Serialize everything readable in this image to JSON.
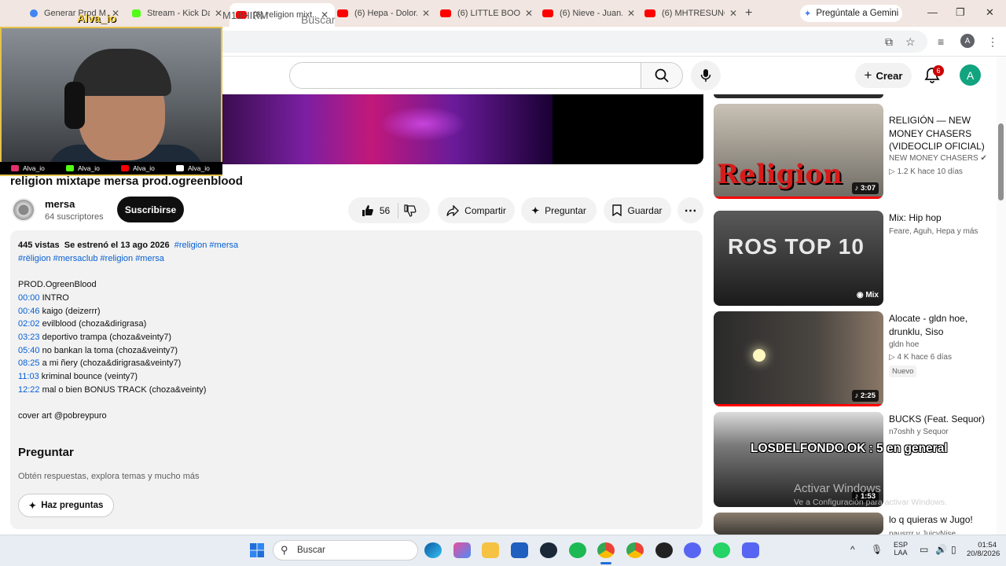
{
  "browser": {
    "tabs": [
      {
        "title": "Generar Prod M...",
        "color": "#4285f4"
      },
      {
        "title": "Stream - Kick Da...",
        "color": "#53fc18"
      },
      {
        "title": "(6) religion mixt...",
        "color": "#ff0000"
      },
      {
        "title": "(6) Hepa - Dolor...",
        "color": "#ff0000"
      },
      {
        "title": "(6) LITTLE BOOG...",
        "color": "#ff0000"
      },
      {
        "title": "(6) Nieve - Juan...",
        "color": "#ff0000"
      },
      {
        "title": "(6) MHTRESUNC...",
        "color": "#ff0000"
      }
    ],
    "tab_close": "✕",
    "new_tab": "+",
    "gemini_label": "Pregúntale a Gemini",
    "url_fragment": "M1dHIRM",
    "profile_initial": "A",
    "window_controls": [
      "—",
      "❐",
      "✕"
    ]
  },
  "webcam": {
    "streamer_name": "Alva_io",
    "socials": [
      {
        "label": "Alva_io",
        "color": "#e1306c"
      },
      {
        "label": "Alva_io",
        "color": "#53fc18"
      },
      {
        "label": "Alva_io",
        "color": "#ff0000"
      },
      {
        "label": "Alva_io",
        "color": "#ffffff"
      }
    ]
  },
  "header": {
    "search_placeholder": "Buscar",
    "create_label": "Crear",
    "notifications_count": "6",
    "avatar_initial": "A"
  },
  "video": {
    "title": "religion mixtape mersa prod.ogreenblood",
    "channel_name": "mersa",
    "subscribers": "64 suscriptores",
    "subscribe_label": "Suscribirse",
    "likes": "56",
    "share_label": "Compartir",
    "ask_label": "Preguntar",
    "save_label": "Guardar",
    "more_label": "⋯"
  },
  "description": {
    "views": "445 vistas",
    "premiered": "Se estrenó el 13 ago 2026",
    "hashtags_1": "#religion #mersa",
    "hashtags_2": "#rëligion #mersaclub #religion #mersa",
    "producer": "PROD.OgreenBlood",
    "chapters": [
      {
        "time": "00:00",
        "label": "INTRO"
      },
      {
        "time": "00:46",
        "label": "kaigo (deizerrr)"
      },
      {
        "time": "02:02",
        "label": "evilblood (choza&dirigrasa)"
      },
      {
        "time": "03:23",
        "label": "deportivo trampa (choza&veinty7)"
      },
      {
        "time": "05:40",
        "label": "no bankan la toma (choza&veinty7)"
      },
      {
        "time": "08:25",
        "label": "a mi ñery (choza&dirigrasa&veinty7)"
      },
      {
        "time": "11:03",
        "label": "kriminal bounce (veinty7)"
      },
      {
        "time": "12:22",
        "label": "mal o bien BONUS TRACK (choza&veinty)"
      }
    ],
    "cover_art": "cover art @pobreypuro",
    "ask_title": "Preguntar",
    "ask_subtitle": "Obtén respuestas, explora temas y mucho más",
    "ask_button": "Haz preguntas"
  },
  "recommendations": [
    {
      "title": "RELIGIÓN — NEW MONEY CHASERS (VIDEOCLIP OFICIAL)",
      "channel": "NEW MONEY CHASERS",
      "stats": "1.2 K   hace 10 días",
      "duration": "3:07",
      "thumb_text": "Religion",
      "colors": [
        "#c9c2b5",
        "#6e6a63"
      ]
    },
    {
      "title": "Mix: Hip hop",
      "channel": "Feare, Aguh, Hepa y más",
      "stats": "",
      "duration": "Mix",
      "thumb_text": "ROS TOP 10",
      "colors": [
        "#5a5a5a",
        "#1a1a1a"
      ]
    },
    {
      "title": "Alocate - gldn hoe, drunklu, Siso",
      "channel": "gldn hoe",
      "stats": "4 K   hace 6 días",
      "duration": "2:25",
      "badge": "Nuevo",
      "colors": [
        "#3a3a3a",
        "#101010"
      ]
    },
    {
      "title": "BUCKS (Feat. Sequor)",
      "channel": "n7oshh y Sequor",
      "stats": "",
      "duration": "1:53",
      "colors": [
        "#7a7a7a",
        "#202020"
      ]
    },
    {
      "title": "lo q quieras w Jugo!",
      "channel": "pausrrr y JuicyNise",
      "stats": "",
      "duration": "",
      "colors": [
        "#8a7d6e",
        "#3e3a36"
      ]
    }
  ],
  "overlays": {
    "stream_text": "LOSDELFONDO.OK : 5 en general",
    "activate_title": "Activar Windows",
    "activate_sub": "Ve a Configuración para activar Windows."
  },
  "taskbar": {
    "search_label": "Buscar",
    "lang_1": "ESP",
    "lang_2": "LAA",
    "time": "01:54",
    "date": "20/8/2026"
  }
}
